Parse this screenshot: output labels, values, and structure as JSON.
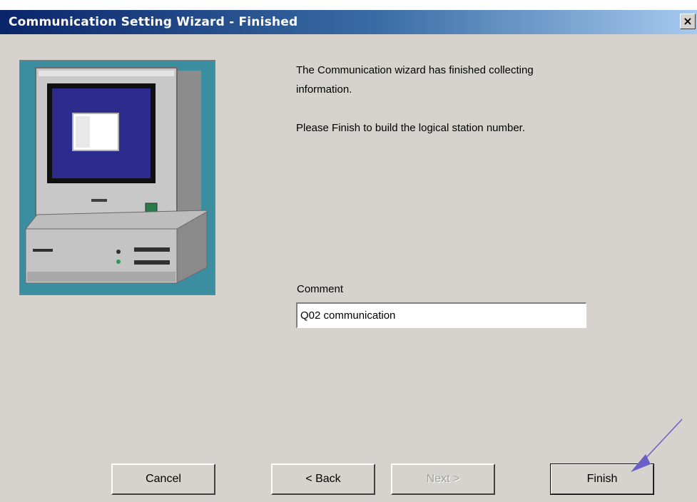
{
  "window": {
    "title": "Communication Setting Wizard - Finished",
    "close_glyph": "×"
  },
  "content": {
    "message_line1": "The Communication wizard has finished collecting",
    "message_line2": "information.",
    "message_line3": "Please Finish to build the logical station number.",
    "comment_label": "Comment",
    "comment_value": "Q02 communication"
  },
  "buttons": {
    "cancel": "Cancel",
    "back": "< Back",
    "next": "Next >",
    "finish": "Finish"
  },
  "illustration": {
    "icon": "computer-icon",
    "background_color": "#3a8ea0"
  },
  "annotation": {
    "icon": "arrow-icon",
    "color": "#6b5fc7"
  }
}
